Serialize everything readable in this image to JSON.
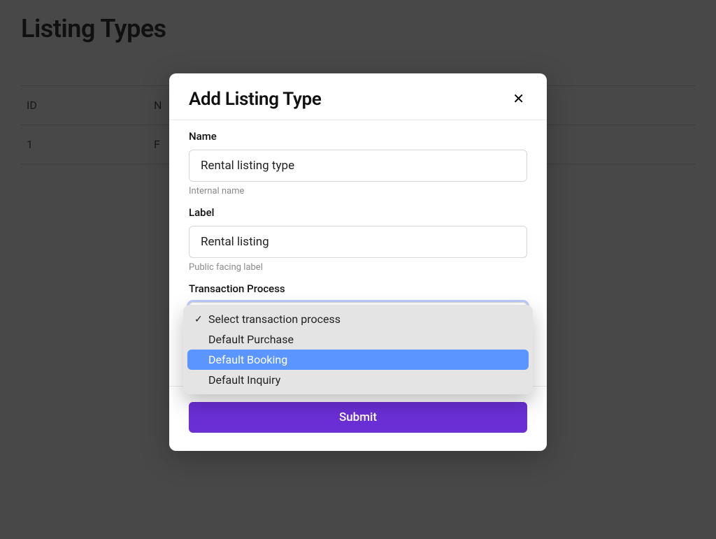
{
  "page": {
    "title": "Listing Types",
    "table": {
      "headers": {
        "id": "ID",
        "name": "N"
      },
      "rows": [
        {
          "id": "1",
          "name": "F"
        }
      ]
    }
  },
  "modal": {
    "title": "Add Listing Type",
    "close_icon": "✕",
    "fields": {
      "name": {
        "label": "Name",
        "value": "Rental listing type",
        "helper": "Internal name"
      },
      "label": {
        "label": "Label",
        "value": "Rental listing",
        "helper": "Public facing label"
      },
      "transaction_process": {
        "label": "Transaction Process",
        "options": [
          {
            "label": "Select transaction process",
            "checked": true,
            "highlighted": false
          },
          {
            "label": "Default Purchase",
            "checked": false,
            "highlighted": false
          },
          {
            "label": "Default Booking",
            "checked": false,
            "highlighted": true
          },
          {
            "label": "Default Inquiry",
            "checked": false,
            "highlighted": false
          }
        ]
      }
    },
    "submit_label": "Submit"
  },
  "colors": {
    "accent": "#6b2fd6",
    "dropdown_highlight": "#5b95ff"
  }
}
